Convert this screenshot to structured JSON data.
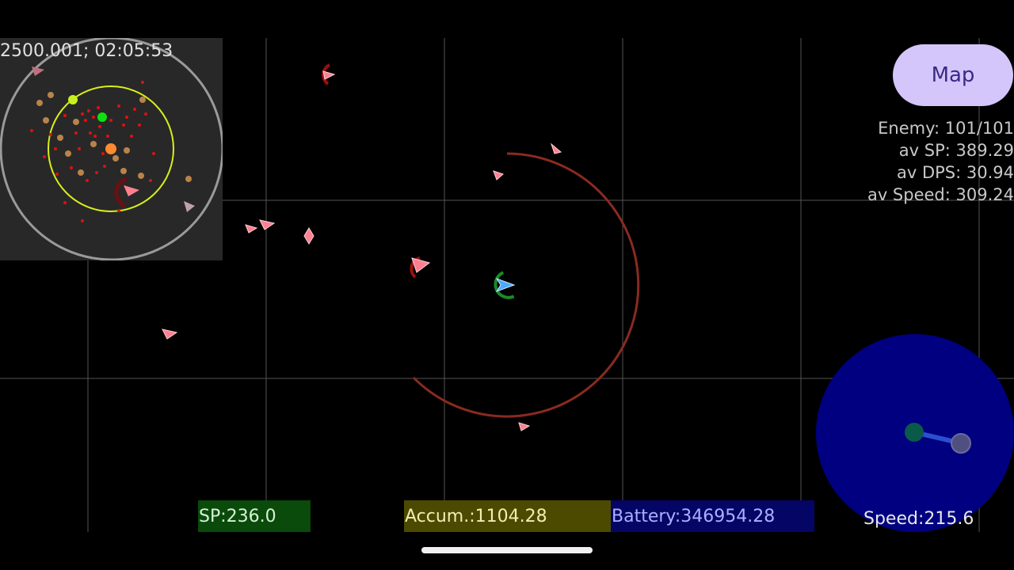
{
  "hud": {
    "coords": "2500.001; 02:05:53",
    "map_button": "Map",
    "stats": {
      "enemy": "Enemy: 101/101",
      "av_sp": "av SP: 389.29",
      "av_dps": "av DPS: 30.94",
      "av_speed": "av Speed: 309.24"
    },
    "sp_bar": "SP:236.0",
    "accum_bar": "Accum.:1104.28",
    "battery_bar": "Battery:346954.28",
    "speed": "Speed:215.6"
  },
  "colors": {
    "sp_bar": "#0a4a0a",
    "accum_bar": "#4c4a00",
    "battery_bar": "#050565",
    "map_button": "#d4c6fb",
    "enemy": "#ff6070",
    "player": "#4aa8ff",
    "range_ring": "#8a2a20",
    "joystick": "#000080"
  }
}
